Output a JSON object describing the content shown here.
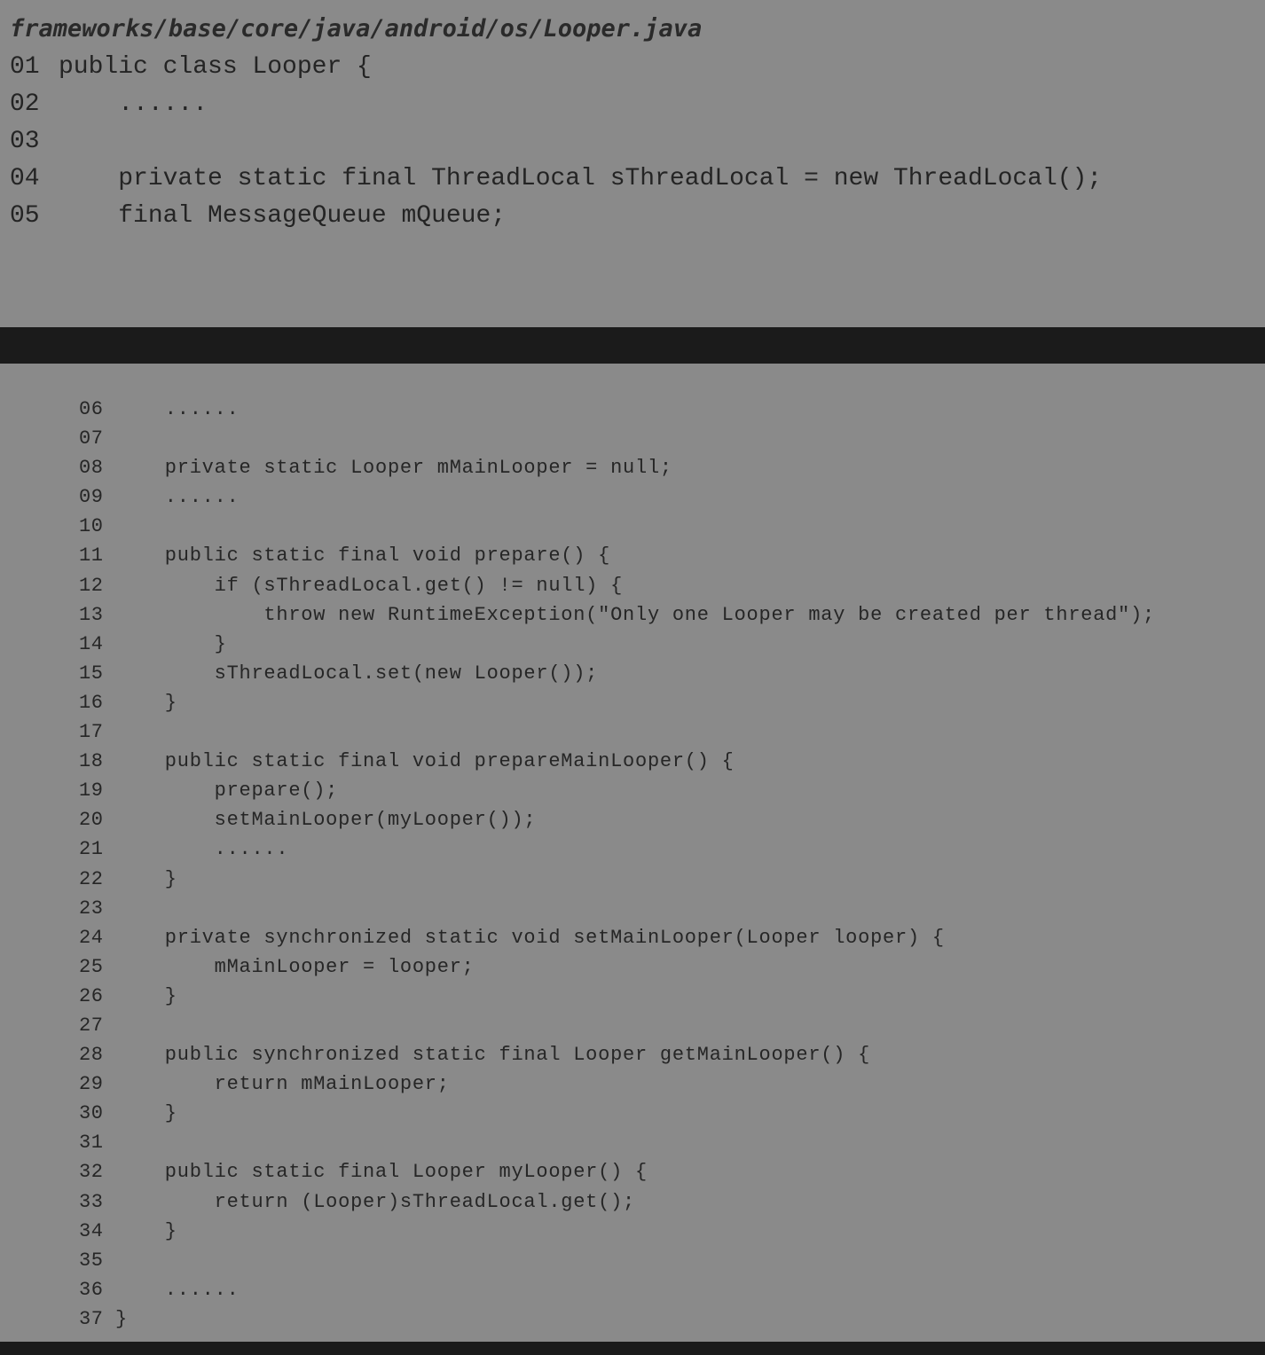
{
  "file_path": "frameworks/base/core/java/android/os/Looper.java",
  "code_top": [
    {
      "num": "01",
      "text": "public class Looper {"
    },
    {
      "num": "02",
      "text": "    ......"
    },
    {
      "num": "03",
      "text": ""
    },
    {
      "num": "04",
      "text": "    private static final ThreadLocal sThreadLocal = new ThreadLocal();"
    },
    {
      "num": "05",
      "text": "    final MessageQueue mQueue;"
    }
  ],
  "code_bottom": [
    {
      "num": "06",
      "text": "    ......"
    },
    {
      "num": "07",
      "text": ""
    },
    {
      "num": "08",
      "text": "    private static Looper mMainLooper = null;"
    },
    {
      "num": "09",
      "text": "    ......"
    },
    {
      "num": "10",
      "text": ""
    },
    {
      "num": "11",
      "text": "    public static final void prepare() {"
    },
    {
      "num": "12",
      "text": "        if (sThreadLocal.get() != null) {"
    },
    {
      "num": "13",
      "text": "            throw new RuntimeException(\"Only one Looper may be created per thread\");"
    },
    {
      "num": "14",
      "text": "        }"
    },
    {
      "num": "15",
      "text": "        sThreadLocal.set(new Looper());"
    },
    {
      "num": "16",
      "text": "    }"
    },
    {
      "num": "17",
      "text": ""
    },
    {
      "num": "18",
      "text": "    public static final void prepareMainLooper() {"
    },
    {
      "num": "19",
      "text": "        prepare();"
    },
    {
      "num": "20",
      "text": "        setMainLooper(myLooper());"
    },
    {
      "num": "21",
      "text": "        ......"
    },
    {
      "num": "22",
      "text": "    }"
    },
    {
      "num": "23",
      "text": ""
    },
    {
      "num": "24",
      "text": "    private synchronized static void setMainLooper(Looper looper) {"
    },
    {
      "num": "25",
      "text": "        mMainLooper = looper;"
    },
    {
      "num": "26",
      "text": "    }"
    },
    {
      "num": "27",
      "text": ""
    },
    {
      "num": "28",
      "text": "    public synchronized static final Looper getMainLooper() {"
    },
    {
      "num": "29",
      "text": "        return mMainLooper;"
    },
    {
      "num": "30",
      "text": "    }"
    },
    {
      "num": "31",
      "text": ""
    },
    {
      "num": "32",
      "text": "    public static final Looper myLooper() {"
    },
    {
      "num": "33",
      "text": "        return (Looper)sThreadLocal.get();"
    },
    {
      "num": "34",
      "text": "    }"
    },
    {
      "num": "35",
      "text": ""
    },
    {
      "num": "36",
      "text": "    ......"
    },
    {
      "num": "37",
      "text": "}"
    }
  ]
}
